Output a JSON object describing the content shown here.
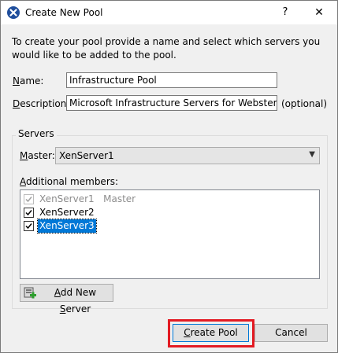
{
  "window": {
    "title": "Create New Pool",
    "help": "?",
    "close": "✕"
  },
  "intro_text": "To create your pool provide a name and select which servers you would like to be added to the pool.",
  "name_field": {
    "label": "Name:",
    "value": "Infrastructure Pool"
  },
  "description_field": {
    "label": "Description:",
    "value": "Microsoft Infrastructure Servers for Webster's Lab",
    "suffix": "(optional)"
  },
  "servers_group": {
    "title": "Servers",
    "master_label": "Master:",
    "master_value": "XenServer1",
    "additional_label": "Additional members:",
    "members": [
      {
        "name": "XenServer1",
        "note": "Master",
        "checked": true,
        "disabled": true,
        "selected": false
      },
      {
        "name": "XenServer2",
        "note": "",
        "checked": true,
        "disabled": false,
        "selected": false
      },
      {
        "name": "XenServer3",
        "note": "",
        "checked": true,
        "disabled": false,
        "selected": true
      }
    ],
    "add_button": "Add New Server"
  },
  "buttons": {
    "create": "Create Pool",
    "cancel": "Cancel"
  },
  "colors": {
    "highlight": "#e31b23",
    "selection": "#0078d7"
  }
}
